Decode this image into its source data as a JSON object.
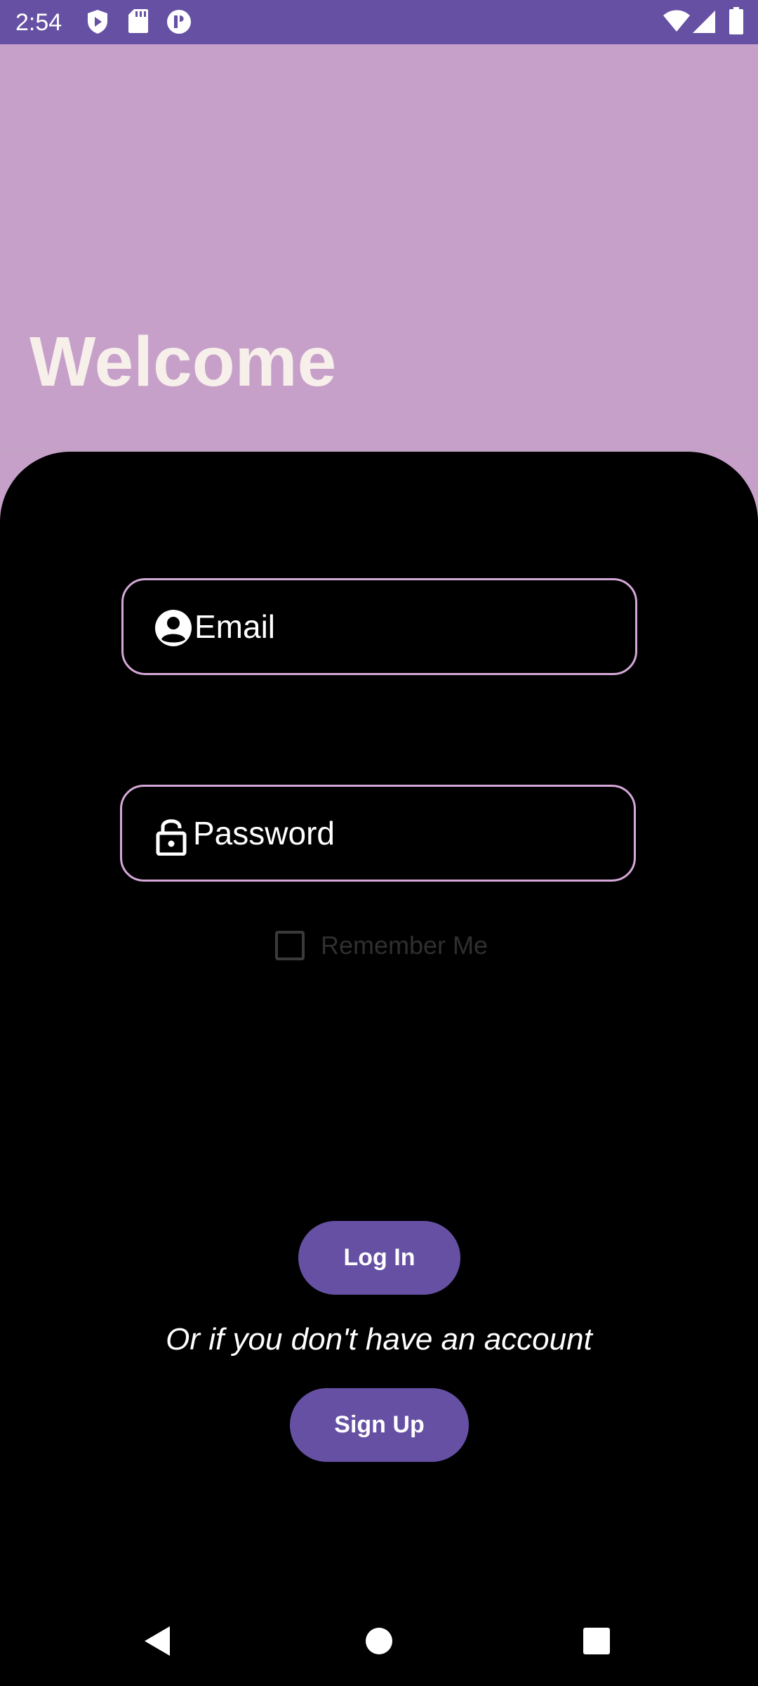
{
  "status_bar": {
    "time": "2:54",
    "left_icons": [
      "shield-play-icon",
      "sd-card-icon",
      "data-saver-icon"
    ],
    "right_icons": [
      "wifi-icon",
      "cell-signal-icon",
      "battery-icon"
    ]
  },
  "header": {
    "title": "Welcome",
    "background": "#c7a0ca",
    "title_color": "#f6efea"
  },
  "form": {
    "email": {
      "placeholder": "Email",
      "icon": "account-circle-icon"
    },
    "password": {
      "placeholder": "Password",
      "icon": "lock-open-icon"
    },
    "remember_me": {
      "label": "Remember Me",
      "checked": false
    },
    "field_border_color": "#d4a8d8"
  },
  "actions": {
    "login_label": "Log In",
    "alt_prompt": "Or if you don't have an account",
    "signup_label": "Sign Up",
    "button_color": "#6650a4"
  },
  "nav_bar": {
    "buttons": [
      "back-icon",
      "home-icon",
      "recents-icon"
    ]
  }
}
